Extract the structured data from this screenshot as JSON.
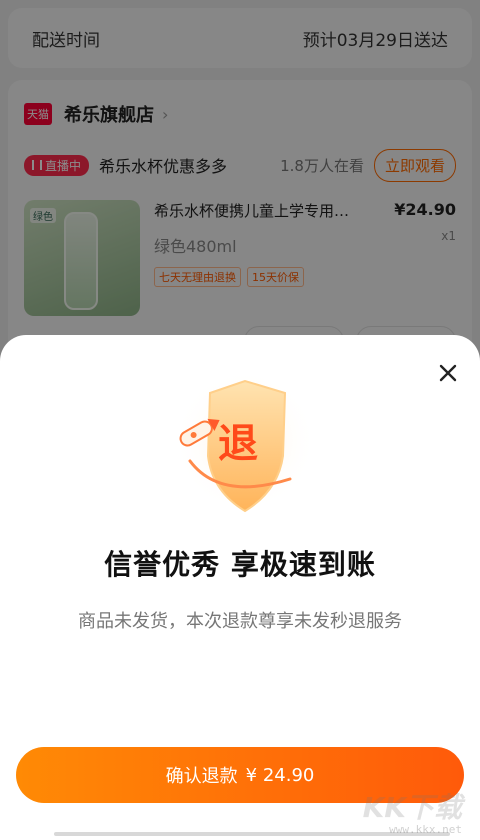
{
  "delivery": {
    "label": "配送时间",
    "value": "预计03月29日送达"
  },
  "store": {
    "badge": "天猫",
    "name": "希乐旗舰店",
    "live": {
      "badge": "直播中",
      "text": "希乐水杯优惠多多",
      "viewers": "1.8万人在看",
      "watch_label": "立即观看"
    }
  },
  "product": {
    "title": "希乐水杯便携儿童上学专用…",
    "spec": "绿色480ml",
    "tags": [
      "七天无理由退换",
      "15天价保"
    ],
    "price": "¥24.90",
    "qty": "x1",
    "thumb_label": "绿色"
  },
  "sheet": {
    "icon_char": "退",
    "headline": "信誉优秀 享极速到账",
    "subline": "商品未发货，本次退款尊享未发秒退服务",
    "confirm_label": "确认退款",
    "confirm_amount": "¥ 24.90"
  },
  "watermark": {
    "brand": "KK下载",
    "url": "www.kkx.net"
  },
  "colors": {
    "accent": "#ff6a00",
    "button_start": "#ff8a05",
    "button_end": "#ff5a0a",
    "tmall": "#ff0036"
  }
}
